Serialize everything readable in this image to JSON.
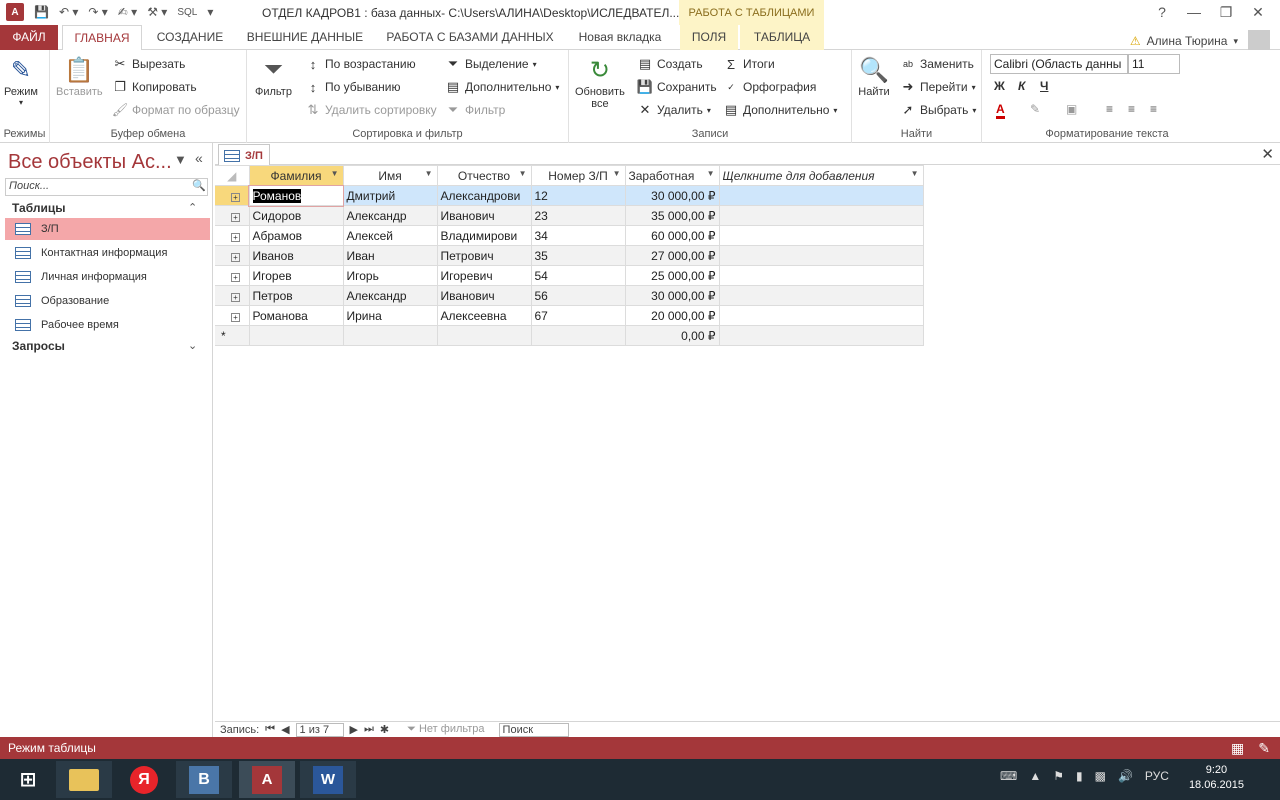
{
  "title_bar": {
    "document_title": "ОТДЕЛ КАДРОВ1 : база данных- C:\\Users\\АЛИНА\\Desktop\\ИСЛЕДВАТЕЛ...",
    "context_tab_group": "РАБОТА С ТАБЛИЦАМИ",
    "sql_label": "SQL",
    "help_label": "?"
  },
  "ribbon_tabs": [
    "ФАЙЛ",
    "ГЛАВНАЯ",
    "СОЗДАНИЕ",
    "ВНЕШНИЕ ДАННЫЕ",
    "РАБОТА С БАЗАМИ ДАННЫХ",
    "Новая вкладка",
    "ПОЛЯ",
    "ТАБЛИЦА"
  ],
  "user_name": "Алина Тюрина",
  "ribbon": {
    "views": {
      "mode": "Режим",
      "group": "Режимы"
    },
    "clipboard": {
      "paste": "Вставить",
      "cut": "Вырезать",
      "copy": "Копировать",
      "format_painter": "Формат по образцу",
      "group": "Буфер обмена"
    },
    "sort_filter": {
      "filter": "Фильтр",
      "ascending": "По возрастанию",
      "descending": "По убыванию",
      "remove_sort": "Удалить сортировку",
      "selection": "Выделение",
      "advanced": "Дополнительно",
      "toggle_filter": "Фильтр",
      "group": "Сортировка и фильтр"
    },
    "records": {
      "refresh_line1": "Обновить",
      "refresh_line2": "все",
      "new": "Создать",
      "save": "Сохранить",
      "delete": "Удалить",
      "totals": "Итоги",
      "spelling": "Орфография",
      "more": "Дополнительно",
      "group": "Записи"
    },
    "find": {
      "find": "Найти",
      "replace": "Заменить",
      "goto": "Перейти",
      "select": "Выбрать",
      "group": "Найти"
    },
    "text_format": {
      "font": "Calibri (Область данны",
      "size": "11",
      "bold": "Ж",
      "italic": "К",
      "underline": "Ч",
      "group": "Форматирование текста"
    }
  },
  "nav": {
    "title": "Все объекты Ас...",
    "search_placeholder": "Поиск...",
    "tables_header": "Таблицы",
    "tables": [
      "З/П",
      "Контактная информация",
      "Личная информация",
      "Образование",
      "Рабочее время"
    ],
    "queries_header": "Запросы"
  },
  "object_tab": "З/П",
  "grid": {
    "columns": [
      "Фамилия",
      "Имя",
      "Отчество",
      "Номер З/П",
      "Заработная",
      "Щелкните для добавления"
    ],
    "rows": [
      [
        "Романов",
        "Дмитрий",
        "Александрови",
        "12",
        "30 000,00 ₽"
      ],
      [
        "Сидоров",
        "Александр",
        "Иванович",
        "23",
        "35 000,00 ₽"
      ],
      [
        "Абрамов",
        "Алексей",
        "Владимирови",
        "34",
        "60 000,00 ₽"
      ],
      [
        "Иванов",
        "Иван",
        "Петрович",
        "35",
        "27 000,00 ₽"
      ],
      [
        "Игорев",
        "Игорь",
        "Игоревич",
        "54",
        "25 000,00 ₽"
      ],
      [
        "Петров",
        "Александр",
        "Иванович",
        "56",
        "30 000,00 ₽"
      ],
      [
        "Романова",
        "Ирина",
        "Алексеевна",
        "67",
        "20 000,00 ₽"
      ]
    ],
    "new_row_value": "0,00 ₽",
    "new_row_marker": "*"
  },
  "record_nav": {
    "label": "Запись:",
    "position": "1 из 7",
    "filter": "Нет фильтра",
    "search": "Поиск"
  },
  "status_bar": {
    "text": "Режим таблицы"
  },
  "taskbar": {
    "time": "9:20",
    "date": "18.06.2015",
    "lang": "РУС"
  }
}
